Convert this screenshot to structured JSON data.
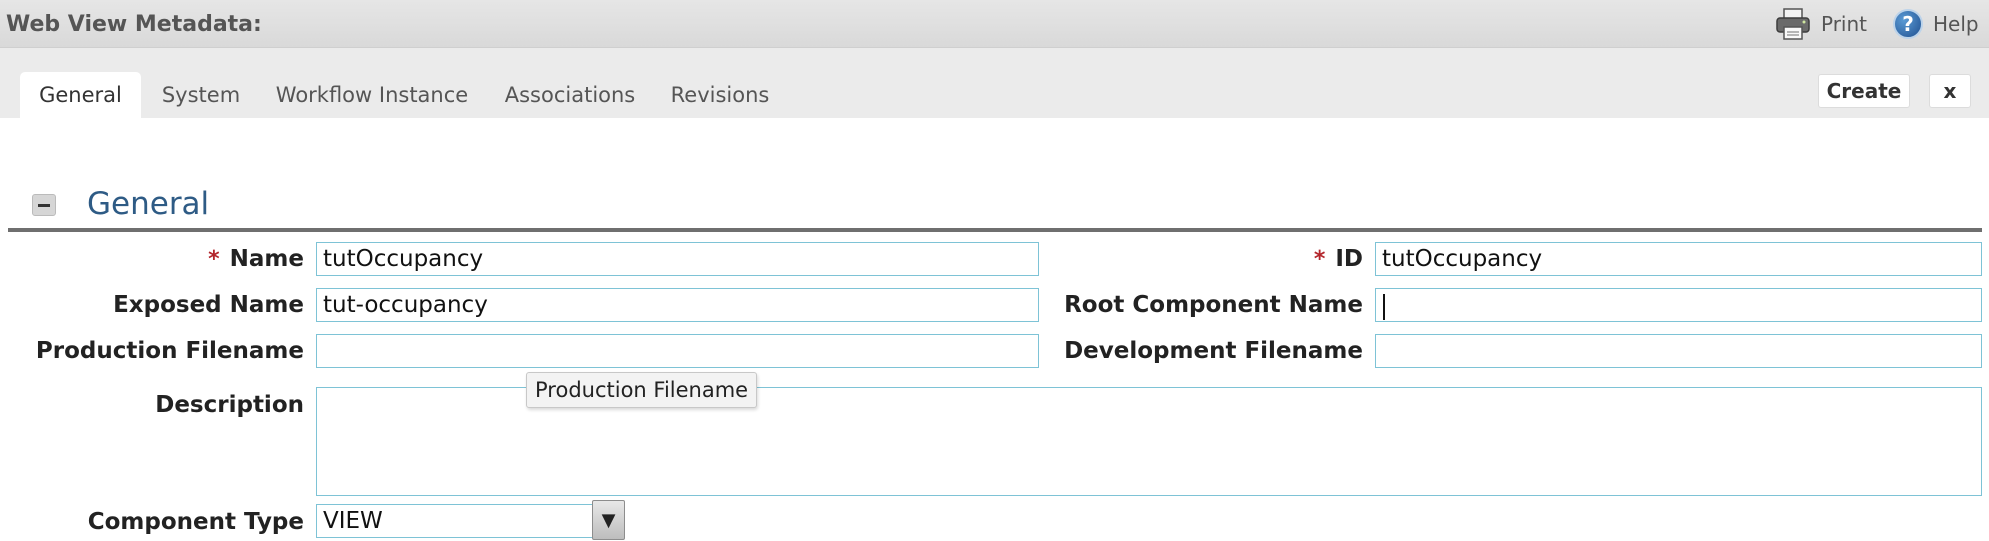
{
  "header": {
    "title": "Web View Metadata:",
    "print_label": "Print",
    "help_label": "Help",
    "help_glyph": "?"
  },
  "tabs": [
    {
      "label": "General",
      "active": true
    },
    {
      "label": "System",
      "active": false
    },
    {
      "label": "Workflow Instance",
      "active": false
    },
    {
      "label": "Associations",
      "active": false
    },
    {
      "label": "Revisions",
      "active": false
    }
  ],
  "toolbar": {
    "create_label": "Create",
    "close_label": "x"
  },
  "section": {
    "title": "General",
    "toggle_state": "expanded"
  },
  "form": {
    "required_marker": "*",
    "name": {
      "label": "Name",
      "value": "tutOccupancy",
      "required": true
    },
    "id": {
      "label": "ID",
      "value": "tutOccupancy",
      "required": true
    },
    "exposed_name": {
      "label": "Exposed Name",
      "value": "tut-occupancy"
    },
    "root_component_name": {
      "label": "Root Component Name",
      "value": ""
    },
    "production_filename": {
      "label": "Production Filename",
      "value": ""
    },
    "development_filename": {
      "label": "Development Filename",
      "value": ""
    },
    "description": {
      "label": "Description",
      "value": ""
    },
    "component_type": {
      "label": "Component Type",
      "value": "VIEW",
      "arrow_glyph": "▼"
    }
  },
  "tooltip": {
    "text": "Production Filename"
  },
  "icons": {
    "print": "printer-icon",
    "help": "question-circle-icon",
    "toggle": "minus-icon",
    "dropdown": "triangle-down-icon"
  },
  "colors": {
    "section_title": "#2e5b85",
    "required": "#b3262c",
    "input_border": "#7ec3d6"
  }
}
